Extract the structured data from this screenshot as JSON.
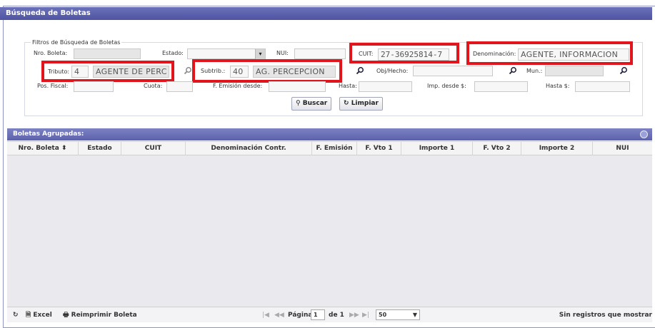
{
  "window": {
    "title": "Búsqueda de Boletas"
  },
  "filters": {
    "legend": "Filtros de Búsqueda de Boletas",
    "nro_boleta_label": "Nro. Boleta:",
    "estado_label": "Estado:",
    "nui_label": "NUI:",
    "cuit_label": "CUIT:",
    "cuit_value": "27-36925814-7",
    "denominacion_label": "Denominación:",
    "denominacion_value": "AGENTE, INFORMACION",
    "tributo_label": "Tributo:",
    "tributo_code": "4",
    "tributo_desc": "AGENTE DE PERC",
    "subtrib_label": "Subtrib.:",
    "subtrib_code": "40",
    "subtrib_desc": "AG. PERCEPCION",
    "obj_hecho_label": "Obj/Hecho:",
    "mun_label": "Mun.:",
    "pos_fiscal_label": "Pos. Fiscal:",
    "cuota_label": "Cuota:",
    "f_emision_desde_label": "F. Emisión desde:",
    "hasta_label": "Hasta:",
    "imp_desde_label": "Imp. desde $:",
    "imp_hasta_label": "Hasta $:"
  },
  "actions": {
    "buscar": "Buscar",
    "limpiar": "Limpiar"
  },
  "grid": {
    "title": "Boletas Agrupadas:",
    "columns": [
      "Nro. Boleta",
      "Estado",
      "CUIT",
      "Denominación Contr.",
      "F. Emisión",
      "F. Vto 1",
      "Importe 1",
      "F. Vto 2",
      "Importe 2",
      "NUI"
    ],
    "sort_indicator": "⬍"
  },
  "footer": {
    "excel": "Excel",
    "reimprimir": "Reimprimir Boleta",
    "pagina_label": "Página",
    "page_value": "1",
    "de_label": "de 1",
    "page_size": "50",
    "status": "Sin registros que mostrar"
  },
  "icons": {
    "refresh": "refresh-icon",
    "excel": "excel-icon",
    "print": "print-icon",
    "search": "search-icon"
  }
}
